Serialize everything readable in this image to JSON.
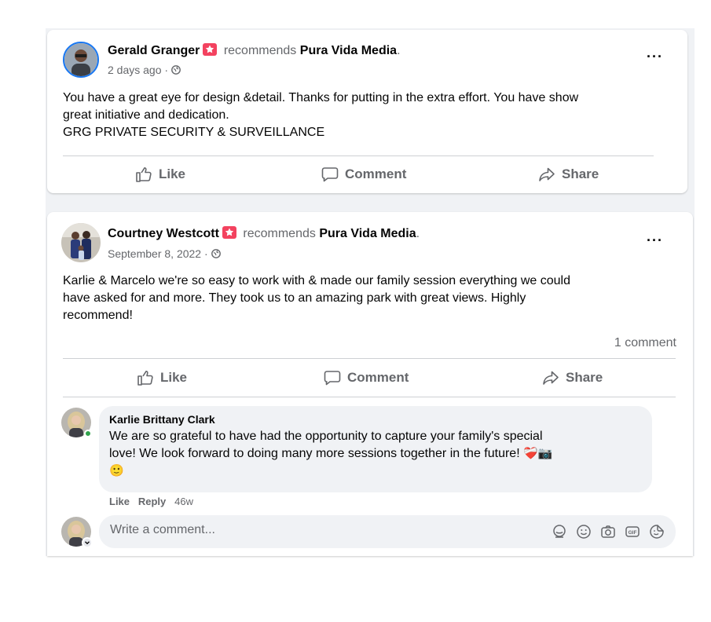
{
  "posts": [
    {
      "author": "Gerald Granger",
      "verb": "recommends",
      "page": "Pura Vida Media",
      "period": ".",
      "time": "2 days ago",
      "sep": " · ",
      "body_lines": [
        "You have a great eye for design &detail. Thanks for putting in the extra effort. You have show",
        "great initiative and dedication.",
        "GRG PRIVATE SECURITY & SURVEILLANCE"
      ],
      "actions": {
        "like": "Like",
        "comment": "Comment",
        "share": "Share"
      }
    },
    {
      "author": "Courtney Westcott",
      "verb": "recommends",
      "page": "Pura Vida Media",
      "period": ".",
      "time": "September 8, 2022",
      "sep": " · ",
      "body_lines": [
        "Karlie & Marcelo we're so easy to work with & made our family session everything we could",
        "have asked for and more. They took us to an amazing park with great views. Highly",
        "recommend!"
      ],
      "comment_count": "1 comment",
      "actions": {
        "like": "Like",
        "comment": "Comment",
        "share": "Share"
      },
      "comment": {
        "author": "Karlie Brittany Clark",
        "lines": [
          "We are so grateful to have had the opportunity to capture your family's special",
          "love! We look forward to doing many more sessions together in the future!"
        ],
        "emoji_line1": "❤️‍🩹📷",
        "emoji_line2": "🙂",
        "like": "Like",
        "reply": "Reply",
        "age": "46w"
      },
      "composer": {
        "placeholder": "Write a comment..."
      }
    }
  ],
  "icons": {
    "more": "more-horizontal-icon",
    "like": "thumbs-up-icon",
    "comment": "comment-bubble-icon",
    "share": "share-arrow-icon",
    "globe": "globe-icon",
    "badge": "recommendation-badge-icon",
    "composer_tools": [
      "avatar-sticker-icon",
      "emoji-icon",
      "camera-icon",
      "gif-icon",
      "sticker-icon"
    ]
  },
  "colors": {
    "badge": "#f3425f",
    "secondary_text": "#65676b",
    "bubble": "#f0f2f5",
    "online": "#31a24c"
  }
}
